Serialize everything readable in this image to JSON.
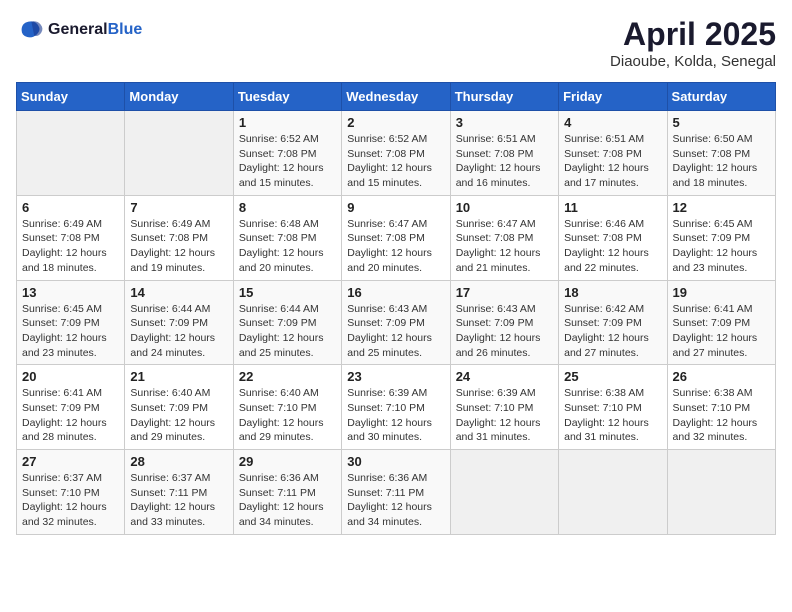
{
  "header": {
    "logo_line1": "General",
    "logo_line2": "Blue",
    "month": "April 2025",
    "location": "Diaoube, Kolda, Senegal"
  },
  "days_of_week": [
    "Sunday",
    "Monday",
    "Tuesday",
    "Wednesday",
    "Thursday",
    "Friday",
    "Saturday"
  ],
  "weeks": [
    [
      {
        "day": "",
        "sunrise": "",
        "sunset": "",
        "daylight": ""
      },
      {
        "day": "",
        "sunrise": "",
        "sunset": "",
        "daylight": ""
      },
      {
        "day": "1",
        "sunrise": "Sunrise: 6:52 AM",
        "sunset": "Sunset: 7:08 PM",
        "daylight": "Daylight: 12 hours and 15 minutes."
      },
      {
        "day": "2",
        "sunrise": "Sunrise: 6:52 AM",
        "sunset": "Sunset: 7:08 PM",
        "daylight": "Daylight: 12 hours and 15 minutes."
      },
      {
        "day": "3",
        "sunrise": "Sunrise: 6:51 AM",
        "sunset": "Sunset: 7:08 PM",
        "daylight": "Daylight: 12 hours and 16 minutes."
      },
      {
        "day": "4",
        "sunrise": "Sunrise: 6:51 AM",
        "sunset": "Sunset: 7:08 PM",
        "daylight": "Daylight: 12 hours and 17 minutes."
      },
      {
        "day": "5",
        "sunrise": "Sunrise: 6:50 AM",
        "sunset": "Sunset: 7:08 PM",
        "daylight": "Daylight: 12 hours and 18 minutes."
      }
    ],
    [
      {
        "day": "6",
        "sunrise": "Sunrise: 6:49 AM",
        "sunset": "Sunset: 7:08 PM",
        "daylight": "Daylight: 12 hours and 18 minutes."
      },
      {
        "day": "7",
        "sunrise": "Sunrise: 6:49 AM",
        "sunset": "Sunset: 7:08 PM",
        "daylight": "Daylight: 12 hours and 19 minutes."
      },
      {
        "day": "8",
        "sunrise": "Sunrise: 6:48 AM",
        "sunset": "Sunset: 7:08 PM",
        "daylight": "Daylight: 12 hours and 20 minutes."
      },
      {
        "day": "9",
        "sunrise": "Sunrise: 6:47 AM",
        "sunset": "Sunset: 7:08 PM",
        "daylight": "Daylight: 12 hours and 20 minutes."
      },
      {
        "day": "10",
        "sunrise": "Sunrise: 6:47 AM",
        "sunset": "Sunset: 7:08 PM",
        "daylight": "Daylight: 12 hours and 21 minutes."
      },
      {
        "day": "11",
        "sunrise": "Sunrise: 6:46 AM",
        "sunset": "Sunset: 7:08 PM",
        "daylight": "Daylight: 12 hours and 22 minutes."
      },
      {
        "day": "12",
        "sunrise": "Sunrise: 6:45 AM",
        "sunset": "Sunset: 7:09 PM",
        "daylight": "Daylight: 12 hours and 23 minutes."
      }
    ],
    [
      {
        "day": "13",
        "sunrise": "Sunrise: 6:45 AM",
        "sunset": "Sunset: 7:09 PM",
        "daylight": "Daylight: 12 hours and 23 minutes."
      },
      {
        "day": "14",
        "sunrise": "Sunrise: 6:44 AM",
        "sunset": "Sunset: 7:09 PM",
        "daylight": "Daylight: 12 hours and 24 minutes."
      },
      {
        "day": "15",
        "sunrise": "Sunrise: 6:44 AM",
        "sunset": "Sunset: 7:09 PM",
        "daylight": "Daylight: 12 hours and 25 minutes."
      },
      {
        "day": "16",
        "sunrise": "Sunrise: 6:43 AM",
        "sunset": "Sunset: 7:09 PM",
        "daylight": "Daylight: 12 hours and 25 minutes."
      },
      {
        "day": "17",
        "sunrise": "Sunrise: 6:43 AM",
        "sunset": "Sunset: 7:09 PM",
        "daylight": "Daylight: 12 hours and 26 minutes."
      },
      {
        "day": "18",
        "sunrise": "Sunrise: 6:42 AM",
        "sunset": "Sunset: 7:09 PM",
        "daylight": "Daylight: 12 hours and 27 minutes."
      },
      {
        "day": "19",
        "sunrise": "Sunrise: 6:41 AM",
        "sunset": "Sunset: 7:09 PM",
        "daylight": "Daylight: 12 hours and 27 minutes."
      }
    ],
    [
      {
        "day": "20",
        "sunrise": "Sunrise: 6:41 AM",
        "sunset": "Sunset: 7:09 PM",
        "daylight": "Daylight: 12 hours and 28 minutes."
      },
      {
        "day": "21",
        "sunrise": "Sunrise: 6:40 AM",
        "sunset": "Sunset: 7:09 PM",
        "daylight": "Daylight: 12 hours and 29 minutes."
      },
      {
        "day": "22",
        "sunrise": "Sunrise: 6:40 AM",
        "sunset": "Sunset: 7:10 PM",
        "daylight": "Daylight: 12 hours and 29 minutes."
      },
      {
        "day": "23",
        "sunrise": "Sunrise: 6:39 AM",
        "sunset": "Sunset: 7:10 PM",
        "daylight": "Daylight: 12 hours and 30 minutes."
      },
      {
        "day": "24",
        "sunrise": "Sunrise: 6:39 AM",
        "sunset": "Sunset: 7:10 PM",
        "daylight": "Daylight: 12 hours and 31 minutes."
      },
      {
        "day": "25",
        "sunrise": "Sunrise: 6:38 AM",
        "sunset": "Sunset: 7:10 PM",
        "daylight": "Daylight: 12 hours and 31 minutes."
      },
      {
        "day": "26",
        "sunrise": "Sunrise: 6:38 AM",
        "sunset": "Sunset: 7:10 PM",
        "daylight": "Daylight: 12 hours and 32 minutes."
      }
    ],
    [
      {
        "day": "27",
        "sunrise": "Sunrise: 6:37 AM",
        "sunset": "Sunset: 7:10 PM",
        "daylight": "Daylight: 12 hours and 32 minutes."
      },
      {
        "day": "28",
        "sunrise": "Sunrise: 6:37 AM",
        "sunset": "Sunset: 7:11 PM",
        "daylight": "Daylight: 12 hours and 33 minutes."
      },
      {
        "day": "29",
        "sunrise": "Sunrise: 6:36 AM",
        "sunset": "Sunset: 7:11 PM",
        "daylight": "Daylight: 12 hours and 34 minutes."
      },
      {
        "day": "30",
        "sunrise": "Sunrise: 6:36 AM",
        "sunset": "Sunset: 7:11 PM",
        "daylight": "Daylight: 12 hours and 34 minutes."
      },
      {
        "day": "",
        "sunrise": "",
        "sunset": "",
        "daylight": ""
      },
      {
        "day": "",
        "sunrise": "",
        "sunset": "",
        "daylight": ""
      },
      {
        "day": "",
        "sunrise": "",
        "sunset": "",
        "daylight": ""
      }
    ]
  ]
}
